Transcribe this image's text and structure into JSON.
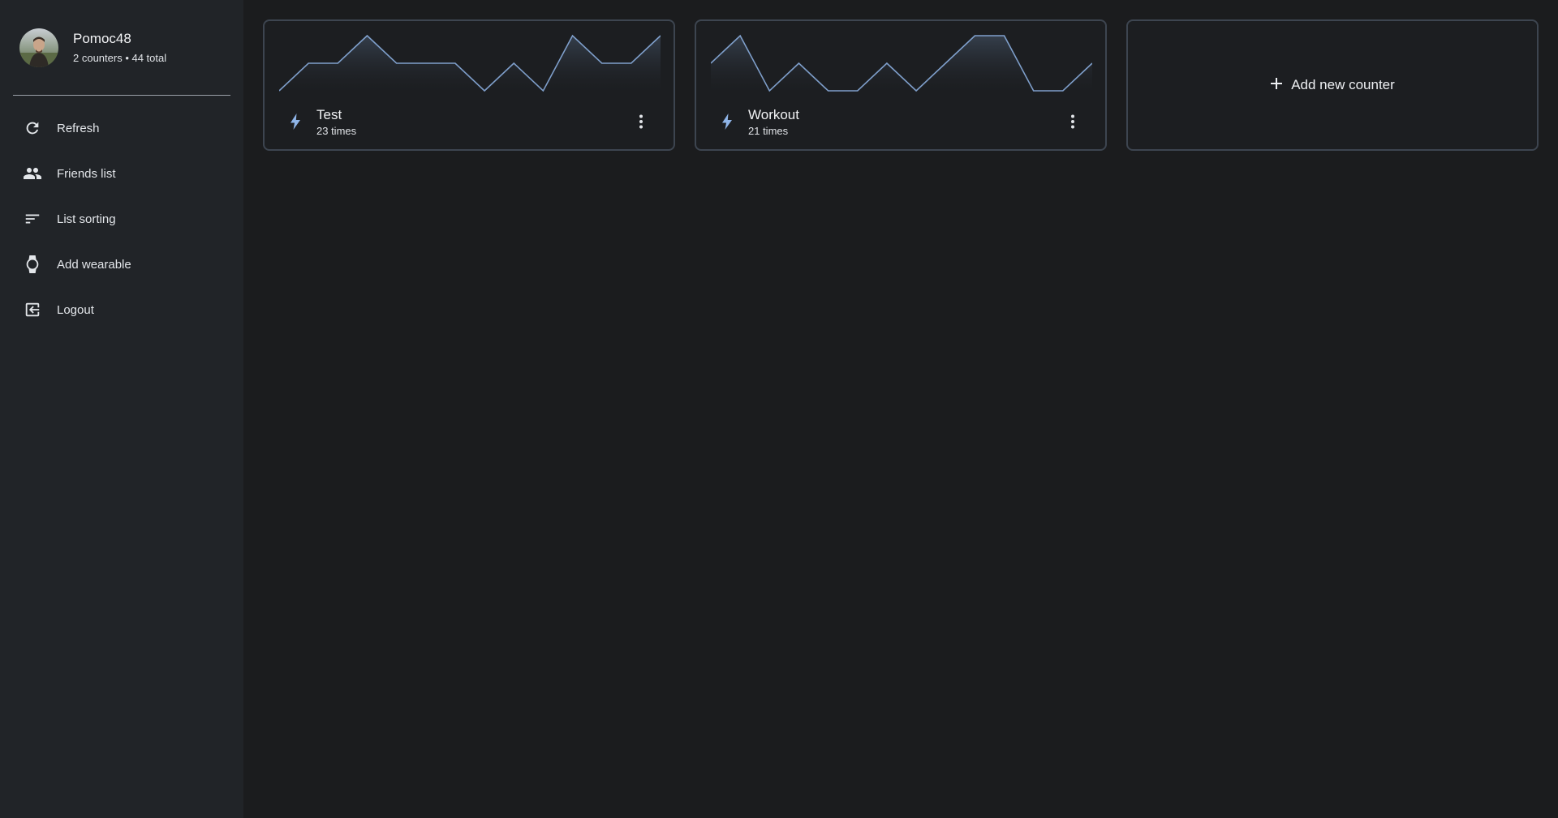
{
  "profile": {
    "name": "Pomoc48",
    "stats": "2 counters • 44 total"
  },
  "sidebar": {
    "items": [
      {
        "label": "Refresh",
        "icon": "refresh-icon"
      },
      {
        "label": "Friends list",
        "icon": "people-icon"
      },
      {
        "label": "List sorting",
        "icon": "sort-icon"
      },
      {
        "label": "Add wearable",
        "icon": "watch-icon"
      },
      {
        "label": "Logout",
        "icon": "logout-icon"
      }
    ]
  },
  "counters": [
    {
      "title": "Test",
      "subtitle": "23 times",
      "icon": "bolt-icon",
      "trend": [
        1,
        2,
        2,
        3,
        2,
        2,
        2,
        1,
        2,
        1,
        3,
        2,
        2,
        3
      ]
    },
    {
      "title": "Workout",
      "subtitle": "21 times",
      "icon": "bolt-icon",
      "trend": [
        2,
        3,
        1,
        2,
        1,
        1,
        2,
        1,
        2,
        3,
        3,
        1,
        1,
        2
      ]
    }
  ],
  "add_counter": {
    "label": "Add new counter",
    "icon": "plus-icon"
  },
  "colors": {
    "accent": "#8fb5e8",
    "sidebar_bg": "#212428",
    "main_bg": "#1b1c1e",
    "card_border": "#3d4550"
  }
}
